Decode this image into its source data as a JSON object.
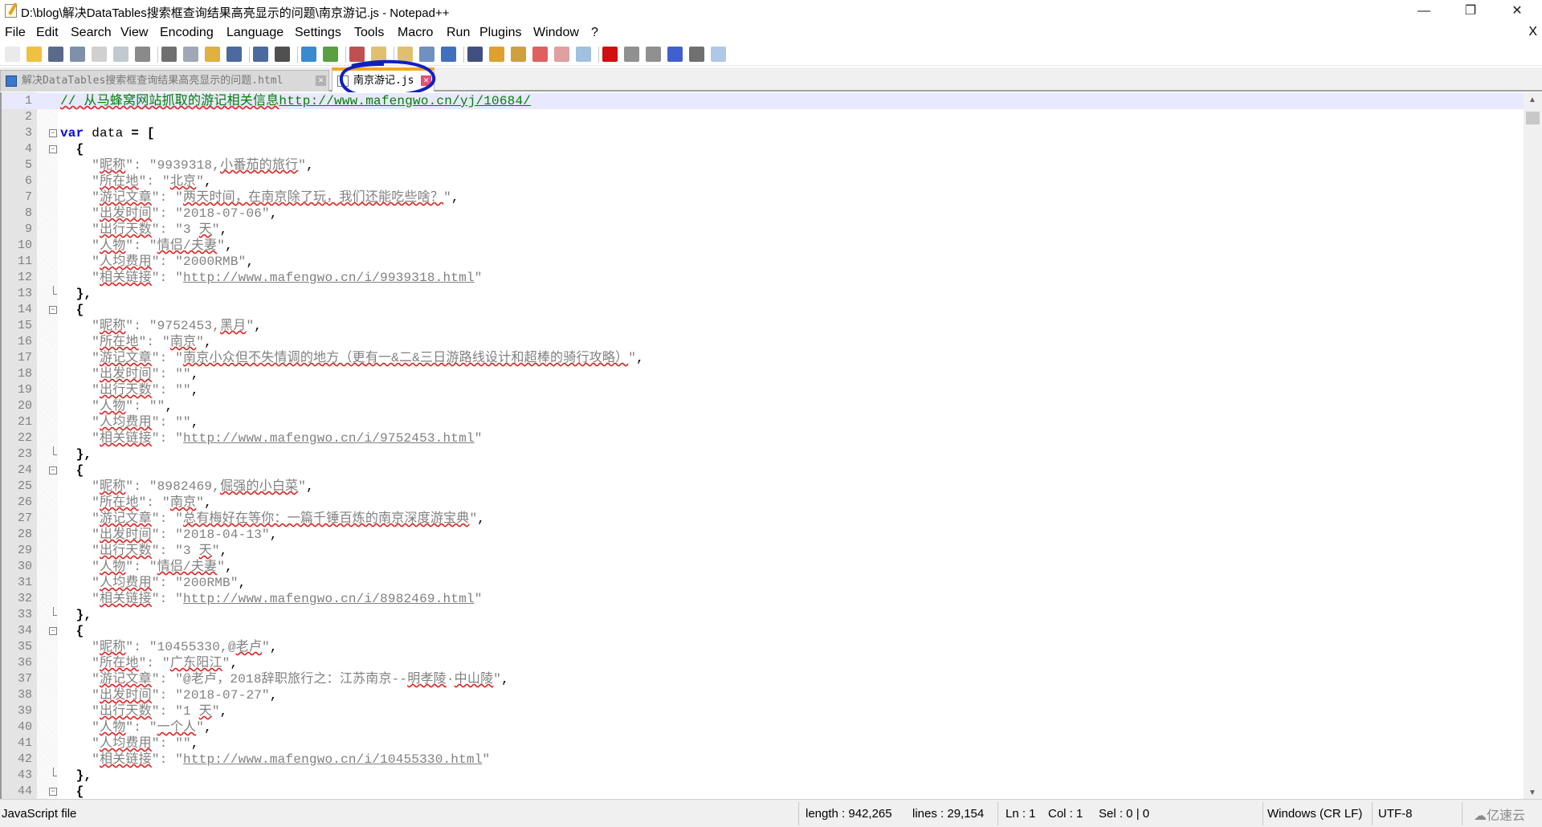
{
  "window": {
    "title": "D:\\blog\\解决DataTables搜索框查询结果高亮显示的问题\\南京游记.js - Notepad++",
    "minimize": "—",
    "restore": "❐",
    "close": "✕"
  },
  "menu": {
    "items": [
      "File",
      "Edit",
      "Search",
      "View",
      "Encoding",
      "Language",
      "Settings",
      "Tools",
      "Macro",
      "Run",
      "Plugins",
      "Window",
      "?"
    ],
    "close": "X"
  },
  "toolbar": {
    "icons": [
      "new-file",
      "open-file",
      "save",
      "save-all",
      "close",
      "close-all",
      "print",
      "cut",
      "copy",
      "paste",
      "undo",
      "redo",
      "find",
      "replace",
      "zoom-in",
      "zoom-out",
      "sync-vertical",
      "sync-horizontal",
      "word-wrap",
      "show-all-chars",
      "indent-guide",
      "doc-map",
      "function-list",
      "folder-workspace",
      "clipboard",
      "monitoring",
      "record-macro",
      "stop-record",
      "play-macro",
      "run-macro-multiple",
      "save-macro",
      "spell-check"
    ],
    "colors": {
      "accent": "#3a78c8",
      "record": "#d01010"
    }
  },
  "tabs": [
    {
      "label": "解决DataTables搜索框查询结果高亮显示的问题.html",
      "active": false
    },
    {
      "label": "南京游记.js",
      "active": true
    }
  ],
  "annotation_color": "#1020c0",
  "editor": {
    "lines": [
      {
        "n": "1",
        "t": [
          [
            "// 从马蜂窝网站抓取的游记相关信息",
            "c sq"
          ],
          [
            "http://www.mafengwo.cn/yj/10684/",
            "cu"
          ]
        ]
      },
      {
        "n": "2",
        "t": []
      },
      {
        "n": "3",
        "t": [
          [
            "var",
            "k"
          ],
          [
            " data ",
            "p"
          ],
          [
            "= [",
            "o"
          ]
        ]
      },
      {
        "n": "4",
        "t": [
          [
            "  {",
            "o"
          ]
        ]
      },
      {
        "n": "5",
        "t": [
          [
            "    \"",
            "s"
          ],
          [
            "昵称",
            "s sq"
          ],
          [
            "\": \"9939318,",
            "s"
          ],
          [
            "小番茄的旅行",
            "s sq"
          ],
          [
            "\"",
            "s"
          ],
          [
            ",",
            "p"
          ]
        ]
      },
      {
        "n": "6",
        "t": [
          [
            "    \"",
            "s"
          ],
          [
            "所在地",
            "s sq"
          ],
          [
            "\": \"",
            "s"
          ],
          [
            "北京",
            "s sq"
          ],
          [
            "\"",
            "s"
          ],
          [
            ",",
            "p"
          ]
        ]
      },
      {
        "n": "7",
        "t": [
          [
            "    \"",
            "s"
          ],
          [
            "游记文章",
            "s sq"
          ],
          [
            "\": \"",
            "s"
          ],
          [
            "两天时间，在南京除了玩，我们还能吃些啥？",
            "s sq"
          ],
          [
            "\"",
            "s"
          ],
          [
            ",",
            "p"
          ]
        ]
      },
      {
        "n": "8",
        "t": [
          [
            "    \"",
            "s"
          ],
          [
            "出发时间",
            "s sq"
          ],
          [
            "\": \"2018-07-06\"",
            "s"
          ],
          [
            ",",
            "p"
          ]
        ]
      },
      {
        "n": "9",
        "t": [
          [
            "    \"",
            "s"
          ],
          [
            "出行天数",
            "s sq"
          ],
          [
            "\": \"3 ",
            "s"
          ],
          [
            "天",
            "s sq"
          ],
          [
            "\"",
            "s"
          ],
          [
            ",",
            "p"
          ]
        ]
      },
      {
        "n": "10",
        "t": [
          [
            "    \"",
            "s"
          ],
          [
            "人物",
            "s sq"
          ],
          [
            "\": \"",
            "s"
          ],
          [
            "情侣/夫妻",
            "s sq"
          ],
          [
            "\"",
            "s"
          ],
          [
            ",",
            "p"
          ]
        ]
      },
      {
        "n": "11",
        "t": [
          [
            "    \"",
            "s"
          ],
          [
            "人均费用",
            "s sq"
          ],
          [
            "\": \"2000RMB\"",
            "s"
          ],
          [
            ",",
            "p"
          ]
        ]
      },
      {
        "n": "12",
        "t": [
          [
            "    \"",
            "s"
          ],
          [
            "相关链接",
            "s sq"
          ],
          [
            "\": \"",
            "s"
          ],
          [
            "http://www.mafengwo.cn/i/9939318.html",
            "u"
          ],
          [
            "\"",
            "s"
          ]
        ]
      },
      {
        "n": "13",
        "t": [
          [
            "  },",
            "o"
          ]
        ]
      },
      {
        "n": "14",
        "t": [
          [
            "  {",
            "o"
          ]
        ]
      },
      {
        "n": "15",
        "t": [
          [
            "    \"",
            "s"
          ],
          [
            "昵称",
            "s sq"
          ],
          [
            "\": \"9752453,",
            "s"
          ],
          [
            "黑月",
            "s sq"
          ],
          [
            "\"",
            "s"
          ],
          [
            ",",
            "p"
          ]
        ]
      },
      {
        "n": "16",
        "t": [
          [
            "    \"",
            "s"
          ],
          [
            "所在地",
            "s sq"
          ],
          [
            "\": \"",
            "s"
          ],
          [
            "南京",
            "s sq"
          ],
          [
            "\"",
            "s"
          ],
          [
            ",",
            "p"
          ]
        ]
      },
      {
        "n": "17",
        "t": [
          [
            "    \"",
            "s"
          ],
          [
            "游记文章",
            "s sq"
          ],
          [
            "\": \"",
            "s"
          ],
          [
            "南京小众但不失情调的地方（更有一&二&三日游路线设计和超棒的骑行攻略）",
            "s sq"
          ],
          [
            "\"",
            "s"
          ],
          [
            ",",
            "p"
          ]
        ]
      },
      {
        "n": "18",
        "t": [
          [
            "    \"",
            "s"
          ],
          [
            "出发时间",
            "s sq"
          ],
          [
            "\": \"\"",
            "s"
          ],
          [
            ",",
            "p"
          ]
        ]
      },
      {
        "n": "19",
        "t": [
          [
            "    \"",
            "s"
          ],
          [
            "出行天数",
            "s sq"
          ],
          [
            "\": \"\"",
            "s"
          ],
          [
            ",",
            "p"
          ]
        ]
      },
      {
        "n": "20",
        "t": [
          [
            "    \"",
            "s"
          ],
          [
            "人物",
            "s sq"
          ],
          [
            "\": \"\"",
            "s"
          ],
          [
            ",",
            "p"
          ]
        ]
      },
      {
        "n": "21",
        "t": [
          [
            "    \"",
            "s"
          ],
          [
            "人均费用",
            "s sq"
          ],
          [
            "\": \"\"",
            "s"
          ],
          [
            ",",
            "p"
          ]
        ]
      },
      {
        "n": "22",
        "t": [
          [
            "    \"",
            "s"
          ],
          [
            "相关链接",
            "s sq"
          ],
          [
            "\": \"",
            "s"
          ],
          [
            "http://www.mafengwo.cn/i/9752453.html",
            "u"
          ],
          [
            "\"",
            "s"
          ]
        ]
      },
      {
        "n": "23",
        "t": [
          [
            "  },",
            "o"
          ]
        ]
      },
      {
        "n": "24",
        "t": [
          [
            "  {",
            "o"
          ]
        ]
      },
      {
        "n": "25",
        "t": [
          [
            "    \"",
            "s"
          ],
          [
            "昵称",
            "s sq"
          ],
          [
            "\": \"8982469,",
            "s"
          ],
          [
            "倔强的小白菜",
            "s sq"
          ],
          [
            "\"",
            "s"
          ],
          [
            ",",
            "p"
          ]
        ]
      },
      {
        "n": "26",
        "t": [
          [
            "    \"",
            "s"
          ],
          [
            "所在地",
            "s sq"
          ],
          [
            "\": \"",
            "s"
          ],
          [
            "南京",
            "s sq"
          ],
          [
            "\"",
            "s"
          ],
          [
            ",",
            "p"
          ]
        ]
      },
      {
        "n": "27",
        "t": [
          [
            "    \"",
            "s"
          ],
          [
            "游记文章",
            "s sq"
          ],
          [
            "\": \"",
            "s"
          ],
          [
            "总有梅好在等你：一篇千锤百炼的南京深度游宝典",
            "s sq"
          ],
          [
            "\"",
            "s"
          ],
          [
            ",",
            "p"
          ]
        ]
      },
      {
        "n": "28",
        "t": [
          [
            "    \"",
            "s"
          ],
          [
            "出发时间",
            "s sq"
          ],
          [
            "\": \"2018-04-13\"",
            "s"
          ],
          [
            ",",
            "p"
          ]
        ]
      },
      {
        "n": "29",
        "t": [
          [
            "    \"",
            "s"
          ],
          [
            "出行天数",
            "s sq"
          ],
          [
            "\": \"3 ",
            "s"
          ],
          [
            "天",
            "s sq"
          ],
          [
            "\"",
            "s"
          ],
          [
            ",",
            "p"
          ]
        ]
      },
      {
        "n": "30",
        "t": [
          [
            "    \"",
            "s"
          ],
          [
            "人物",
            "s sq"
          ],
          [
            "\": \"",
            "s"
          ],
          [
            "情侣/夫妻",
            "s sq"
          ],
          [
            "\"",
            "s"
          ],
          [
            ",",
            "p"
          ]
        ]
      },
      {
        "n": "31",
        "t": [
          [
            "    \"",
            "s"
          ],
          [
            "人均费用",
            "s sq"
          ],
          [
            "\": \"200RMB\"",
            "s"
          ],
          [
            ",",
            "p"
          ]
        ]
      },
      {
        "n": "32",
        "t": [
          [
            "    \"",
            "s"
          ],
          [
            "相关链接",
            "s sq"
          ],
          [
            "\": \"",
            "s"
          ],
          [
            "http://www.mafengwo.cn/i/8982469.html",
            "u"
          ],
          [
            "\"",
            "s"
          ]
        ]
      },
      {
        "n": "33",
        "t": [
          [
            "  },",
            "o"
          ]
        ]
      },
      {
        "n": "34",
        "t": [
          [
            "  {",
            "o"
          ]
        ]
      },
      {
        "n": "35",
        "t": [
          [
            "    \"",
            "s"
          ],
          [
            "昵称",
            "s sq"
          ],
          [
            "\": \"10455330,@",
            "s"
          ],
          [
            "老卢",
            "s sq"
          ],
          [
            "\"",
            "s"
          ],
          [
            ",",
            "p"
          ]
        ]
      },
      {
        "n": "36",
        "t": [
          [
            "    \"",
            "s"
          ],
          [
            "所在地",
            "s sq"
          ],
          [
            "\": \"",
            "s"
          ],
          [
            "广东阳江",
            "s sq"
          ],
          [
            "\"",
            "s"
          ],
          [
            ",",
            "p"
          ]
        ]
      },
      {
        "n": "37",
        "t": [
          [
            "    \"",
            "s"
          ],
          [
            "游记文章",
            "s sq"
          ],
          [
            "\": \"@老卢，2018辞职旅行之：江苏南京--",
            "s"
          ],
          [
            "明孝陵",
            "s sq"
          ],
          [
            "·",
            "s"
          ],
          [
            "中山陵",
            "s sq"
          ],
          [
            "\"",
            "s"
          ],
          [
            ",",
            "p"
          ]
        ]
      },
      {
        "n": "38",
        "t": [
          [
            "    \"",
            "s"
          ],
          [
            "出发时间",
            "s sq"
          ],
          [
            "\": \"2018-07-27\"",
            "s"
          ],
          [
            ",",
            "p"
          ]
        ]
      },
      {
        "n": "39",
        "t": [
          [
            "    \"",
            "s"
          ],
          [
            "出行天数",
            "s sq"
          ],
          [
            "\": \"1 ",
            "s"
          ],
          [
            "天",
            "s sq"
          ],
          [
            "\"",
            "s"
          ],
          [
            ",",
            "p"
          ]
        ]
      },
      {
        "n": "40",
        "t": [
          [
            "    \"",
            "s"
          ],
          [
            "人物",
            "s sq"
          ],
          [
            "\": \"",
            "s"
          ],
          [
            "一个人",
            "s sq"
          ],
          [
            "\"",
            "s"
          ],
          [
            ",",
            "p"
          ]
        ]
      },
      {
        "n": "41",
        "t": [
          [
            "    \"",
            "s"
          ],
          [
            "人均费用",
            "s sq"
          ],
          [
            "\": \"\"",
            "s"
          ],
          [
            ",",
            "p"
          ]
        ]
      },
      {
        "n": "42",
        "t": [
          [
            "    \"",
            "s"
          ],
          [
            "相关链接",
            "s sq"
          ],
          [
            "\": \"",
            "s"
          ],
          [
            "http://www.mafengwo.cn/i/10455330.html",
            "u"
          ],
          [
            "\"",
            "s"
          ]
        ]
      },
      {
        "n": "43",
        "t": [
          [
            "  },",
            "o"
          ]
        ]
      },
      {
        "n": "44",
        "t": [
          [
            "  {",
            "o"
          ]
        ]
      }
    ],
    "fold_open": [
      "3",
      "4",
      "14",
      "24",
      "34",
      "44"
    ],
    "fold_end": [
      "13",
      "23",
      "33",
      "43"
    ]
  },
  "statusbar": {
    "file_type": "JavaScript file",
    "length": "length : 942,265",
    "lines": "lines : 29,154",
    "ln": "Ln : 1",
    "col": "Col : 1",
    "sel": "Sel : 0 | 0",
    "eol": "Windows (CR LF)",
    "encoding": "UTF-8"
  },
  "watermark": "亿速云"
}
